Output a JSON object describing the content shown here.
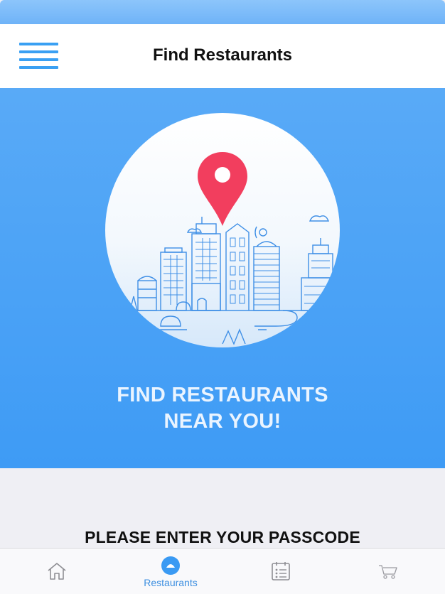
{
  "nav": {
    "title": "Find Restaurants"
  },
  "hero": {
    "line1": "FIND RESTAURANTS",
    "line2": "NEAR YOU!"
  },
  "passcode": {
    "label": "PLEASE ENTER YOUR PASSCODE"
  },
  "tabbar": {
    "tabs": [
      {
        "icon": "home-icon",
        "label": "",
        "active": false
      },
      {
        "icon": "restaurants-icon",
        "label": "Restaurants",
        "active": true
      },
      {
        "icon": "menu-list-icon",
        "label": "",
        "active": false
      },
      {
        "icon": "cart-icon",
        "label": "",
        "active": false
      }
    ]
  },
  "colors": {
    "accent": "#3aa0f3",
    "hero_top": "#59aaf7",
    "hero_bottom": "#3e9bf5",
    "pin": "#f23e5e"
  }
}
